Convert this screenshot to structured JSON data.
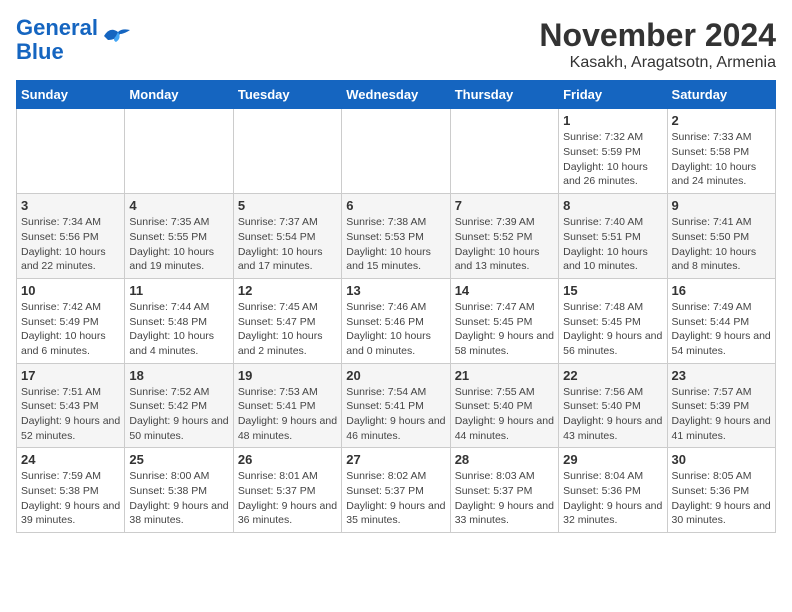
{
  "logo": {
    "line1": "General",
    "line2": "Blue"
  },
  "title": "November 2024",
  "subtitle": "Kasakh, Aragatsotn, Armenia",
  "weekdays": [
    "Sunday",
    "Monday",
    "Tuesday",
    "Wednesday",
    "Thursday",
    "Friday",
    "Saturday"
  ],
  "weeks": [
    [
      {
        "day": "",
        "info": ""
      },
      {
        "day": "",
        "info": ""
      },
      {
        "day": "",
        "info": ""
      },
      {
        "day": "",
        "info": ""
      },
      {
        "day": "",
        "info": ""
      },
      {
        "day": "1",
        "info": "Sunrise: 7:32 AM\nSunset: 5:59 PM\nDaylight: 10 hours and 26 minutes."
      },
      {
        "day": "2",
        "info": "Sunrise: 7:33 AM\nSunset: 5:58 PM\nDaylight: 10 hours and 24 minutes."
      }
    ],
    [
      {
        "day": "3",
        "info": "Sunrise: 7:34 AM\nSunset: 5:56 PM\nDaylight: 10 hours and 22 minutes."
      },
      {
        "day": "4",
        "info": "Sunrise: 7:35 AM\nSunset: 5:55 PM\nDaylight: 10 hours and 19 minutes."
      },
      {
        "day": "5",
        "info": "Sunrise: 7:37 AM\nSunset: 5:54 PM\nDaylight: 10 hours and 17 minutes."
      },
      {
        "day": "6",
        "info": "Sunrise: 7:38 AM\nSunset: 5:53 PM\nDaylight: 10 hours and 15 minutes."
      },
      {
        "day": "7",
        "info": "Sunrise: 7:39 AM\nSunset: 5:52 PM\nDaylight: 10 hours and 13 minutes."
      },
      {
        "day": "8",
        "info": "Sunrise: 7:40 AM\nSunset: 5:51 PM\nDaylight: 10 hours and 10 minutes."
      },
      {
        "day": "9",
        "info": "Sunrise: 7:41 AM\nSunset: 5:50 PM\nDaylight: 10 hours and 8 minutes."
      }
    ],
    [
      {
        "day": "10",
        "info": "Sunrise: 7:42 AM\nSunset: 5:49 PM\nDaylight: 10 hours and 6 minutes."
      },
      {
        "day": "11",
        "info": "Sunrise: 7:44 AM\nSunset: 5:48 PM\nDaylight: 10 hours and 4 minutes."
      },
      {
        "day": "12",
        "info": "Sunrise: 7:45 AM\nSunset: 5:47 PM\nDaylight: 10 hours and 2 minutes."
      },
      {
        "day": "13",
        "info": "Sunrise: 7:46 AM\nSunset: 5:46 PM\nDaylight: 10 hours and 0 minutes."
      },
      {
        "day": "14",
        "info": "Sunrise: 7:47 AM\nSunset: 5:45 PM\nDaylight: 9 hours and 58 minutes."
      },
      {
        "day": "15",
        "info": "Sunrise: 7:48 AM\nSunset: 5:45 PM\nDaylight: 9 hours and 56 minutes."
      },
      {
        "day": "16",
        "info": "Sunrise: 7:49 AM\nSunset: 5:44 PM\nDaylight: 9 hours and 54 minutes."
      }
    ],
    [
      {
        "day": "17",
        "info": "Sunrise: 7:51 AM\nSunset: 5:43 PM\nDaylight: 9 hours and 52 minutes."
      },
      {
        "day": "18",
        "info": "Sunrise: 7:52 AM\nSunset: 5:42 PM\nDaylight: 9 hours and 50 minutes."
      },
      {
        "day": "19",
        "info": "Sunrise: 7:53 AM\nSunset: 5:41 PM\nDaylight: 9 hours and 48 minutes."
      },
      {
        "day": "20",
        "info": "Sunrise: 7:54 AM\nSunset: 5:41 PM\nDaylight: 9 hours and 46 minutes."
      },
      {
        "day": "21",
        "info": "Sunrise: 7:55 AM\nSunset: 5:40 PM\nDaylight: 9 hours and 44 minutes."
      },
      {
        "day": "22",
        "info": "Sunrise: 7:56 AM\nSunset: 5:40 PM\nDaylight: 9 hours and 43 minutes."
      },
      {
        "day": "23",
        "info": "Sunrise: 7:57 AM\nSunset: 5:39 PM\nDaylight: 9 hours and 41 minutes."
      }
    ],
    [
      {
        "day": "24",
        "info": "Sunrise: 7:59 AM\nSunset: 5:38 PM\nDaylight: 9 hours and 39 minutes."
      },
      {
        "day": "25",
        "info": "Sunrise: 8:00 AM\nSunset: 5:38 PM\nDaylight: 9 hours and 38 minutes."
      },
      {
        "day": "26",
        "info": "Sunrise: 8:01 AM\nSunset: 5:37 PM\nDaylight: 9 hours and 36 minutes."
      },
      {
        "day": "27",
        "info": "Sunrise: 8:02 AM\nSunset: 5:37 PM\nDaylight: 9 hours and 35 minutes."
      },
      {
        "day": "28",
        "info": "Sunrise: 8:03 AM\nSunset: 5:37 PM\nDaylight: 9 hours and 33 minutes."
      },
      {
        "day": "29",
        "info": "Sunrise: 8:04 AM\nSunset: 5:36 PM\nDaylight: 9 hours and 32 minutes."
      },
      {
        "day": "30",
        "info": "Sunrise: 8:05 AM\nSunset: 5:36 PM\nDaylight: 9 hours and 30 minutes."
      }
    ]
  ]
}
